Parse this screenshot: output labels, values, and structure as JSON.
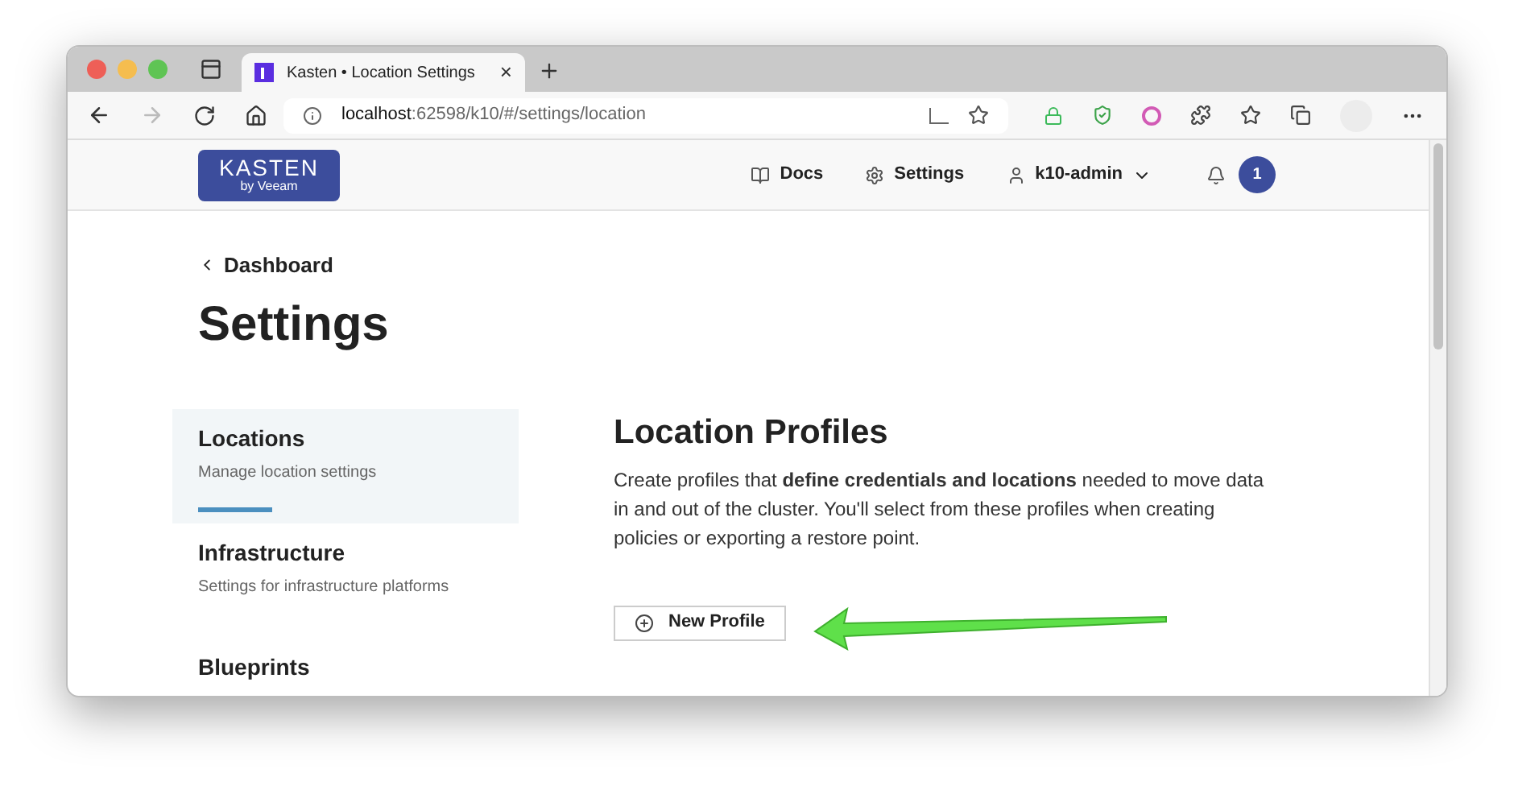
{
  "browser": {
    "tab": {
      "title": "Kasten • Location Settings",
      "close": "×",
      "selected": true
    },
    "address": {
      "host": "localhost",
      "path": ":62598/k10/#/settings/location"
    }
  },
  "header": {
    "logo": {
      "name": "KASTEN",
      "sub": "by Veeam"
    },
    "nav": [
      {
        "label": "Docs",
        "kind": "docs"
      },
      {
        "label": "Settings",
        "kind": "settings"
      },
      {
        "label": "k10-admin",
        "kind": "user"
      }
    ],
    "notifications": "1"
  },
  "back_link": "Dashboard",
  "page_title": "Settings",
  "sidebar": {
    "items": [
      {
        "title": "Locations",
        "subtitle": "Manage location settings",
        "selected": true
      },
      {
        "title": "Infrastructure",
        "subtitle": "Settings for infrastructure platforms",
        "selected": false
      },
      {
        "title": "Blueprints",
        "selected": false
      }
    ]
  },
  "main": {
    "title": "Location Profiles",
    "description": "Create profiles that **define credentials and locations** needed to move data in and out of the cluster. You'll select from these profiles when creating policies or exporting a restore point.",
    "button": "New Profile"
  }
}
